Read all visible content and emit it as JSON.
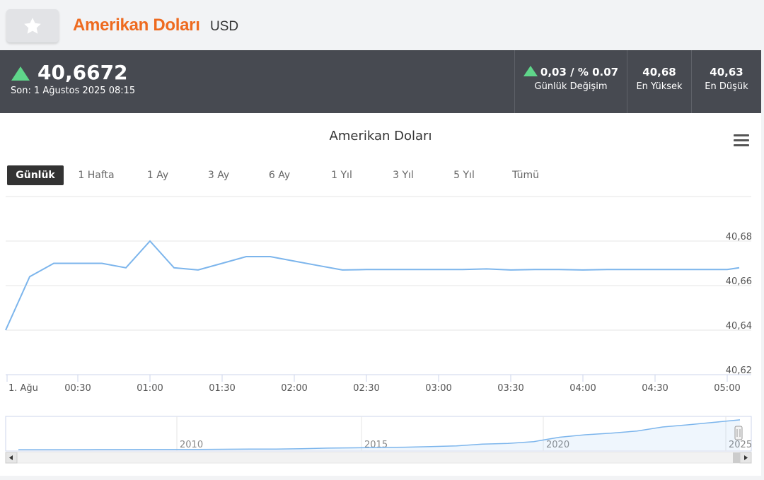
{
  "header": {
    "title": "Amerikan Doları",
    "code": "USD",
    "favorite_icon": "star-icon"
  },
  "stats": {
    "price": "40,6672",
    "last_update": "Son: 1 Ağustos 2025 08:15",
    "change_text": "0,03 / % 0.07",
    "change_label": "Günlük Değişim",
    "high": "40,68",
    "high_label": "En Yüksek",
    "low": "40,63",
    "low_label": "En Düşük",
    "up_color": "#5fd68a"
  },
  "range_selector": {
    "active_index": 0,
    "buttons": [
      "Günlük",
      "1 Hafta",
      "1 Ay",
      "3 Ay",
      "6 Ay",
      "1 Yıl",
      "3 Yıl",
      "5 Yıl",
      "Tümü"
    ]
  },
  "chart_data": {
    "type": "line",
    "title": "Amerikan Doları",
    "series": [
      {
        "color": "#7cb5ec",
        "x": [
          "00:00",
          "00:10",
          "00:20",
          "00:30",
          "00:40",
          "00:50",
          "01:00",
          "01:10",
          "01:20",
          "01:30",
          "01:40",
          "01:50",
          "02:00",
          "02:10",
          "02:20",
          "02:30",
          "02:40",
          "02:50",
          "03:00",
          "03:10",
          "03:20",
          "03:30",
          "03:40",
          "03:50",
          "04:00",
          "04:10",
          "04:20",
          "04:30",
          "04:40",
          "04:50",
          "05:00",
          "05:05"
        ],
        "values": [
          40.64,
          40.664,
          40.67,
          40.67,
          40.67,
          40.668,
          40.68,
          40.668,
          40.667,
          40.67,
          40.673,
          40.673,
          40.671,
          40.669,
          40.667,
          40.6672,
          40.6672,
          40.6672,
          40.6672,
          40.6672,
          40.6675,
          40.667,
          40.6672,
          40.6672,
          40.667,
          40.6672,
          40.6672,
          40.6672,
          40.6672,
          40.6672,
          40.6672,
          40.668
        ]
      }
    ],
    "x_tick_labels": [
      "1. Ağu",
      "00:30",
      "01:00",
      "01:30",
      "02:00",
      "02:30",
      "03:00",
      "03:30",
      "04:00",
      "04:30",
      "05:00"
    ],
    "y_tick_labels": [
      "40,62",
      "40,64",
      "40,66",
      "40,68"
    ],
    "ylim": [
      40.62,
      40.7
    ],
    "xlim_minutes": [
      0,
      310
    ],
    "grid": true,
    "navigator": {
      "x_tick_labels": [
        "2010",
        "2015",
        "2020",
        "2025"
      ],
      "trend": [
        0.02,
        0.02,
        0.02,
        0.025,
        0.025,
        0.03,
        0.03,
        0.03,
        0.035,
        0.04,
        0.04,
        0.05,
        0.07,
        0.08,
        0.09,
        0.1,
        0.12,
        0.14,
        0.2,
        0.22,
        0.28,
        0.42,
        0.5,
        0.55,
        0.62,
        0.75,
        0.82,
        0.9,
        0.98
      ]
    }
  }
}
